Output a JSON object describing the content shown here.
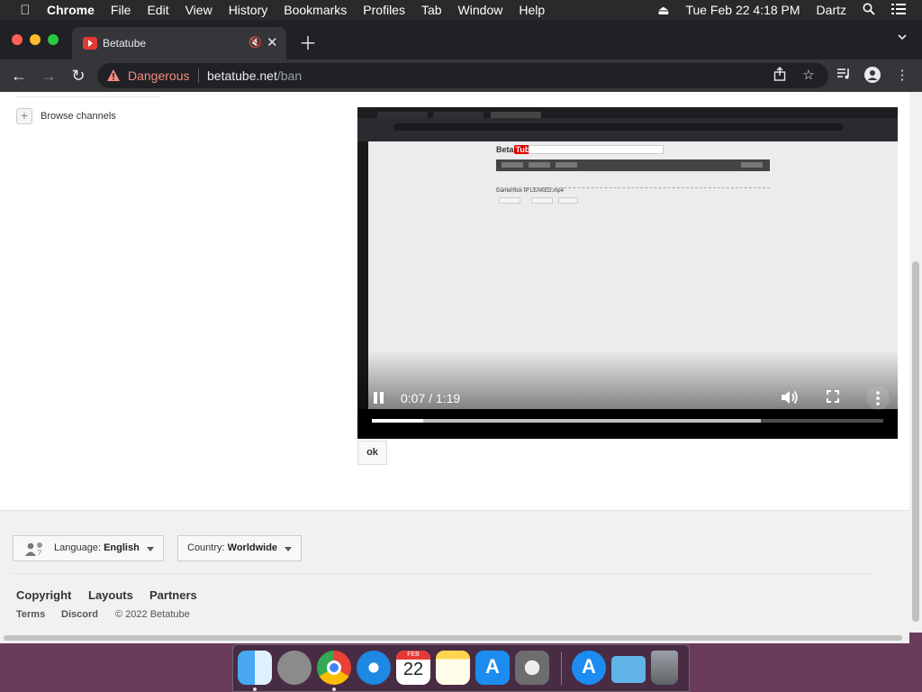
{
  "menubar": {
    "apple": "",
    "app_name": "Chrome",
    "menus": [
      "File",
      "Edit",
      "View",
      "History",
      "Bookmarks",
      "Profiles",
      "Tab",
      "Window",
      "Help"
    ],
    "datetime": "Tue Feb 22  4:18 PM",
    "user": "Dartz"
  },
  "browser": {
    "tab_title": "Betatube",
    "security_label": "Dangerous",
    "url_host": "betatube.net",
    "url_path": "/ban"
  },
  "sidebar": {
    "browse_channels": "Browse channels"
  },
  "player": {
    "time": "0:07 / 1:19",
    "progress_played_fraction": 0.1,
    "progress_buffered_fraction": 0.76,
    "embedded_logo": "Beta",
    "embedded_logo_red": "Tube",
    "embedded_video_title": "GamerNox IP LEAKED.mp4"
  },
  "ok_button": "ok",
  "footer": {
    "language_label": "Language: ",
    "language_value": "English",
    "country_label": "Country: ",
    "country_value": "Worldwide",
    "links": [
      "Copyright",
      "Layouts",
      "Partners"
    ],
    "small_links": [
      "Terms",
      "Discord"
    ],
    "copyright": "© 2022 Betatube"
  },
  "dock": {
    "calendar_month": "FEB",
    "calendar_day": "22"
  }
}
